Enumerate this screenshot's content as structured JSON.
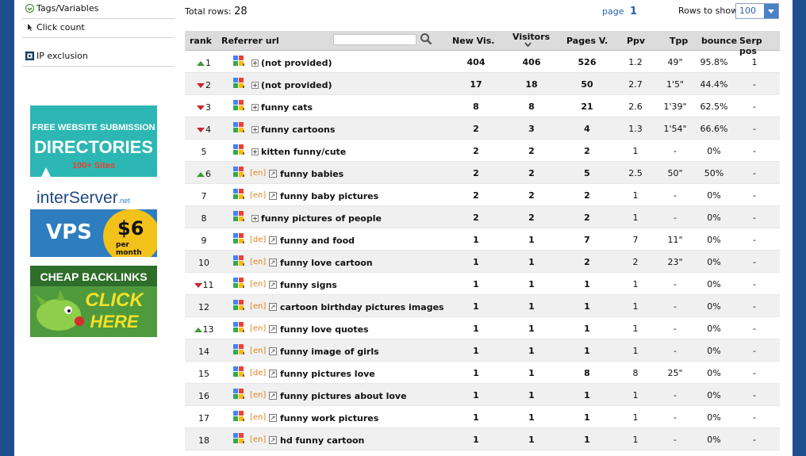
{
  "sidebar": {
    "items": [
      {
        "label": "Tags/Variables",
        "icon": "tag-icon"
      },
      {
        "label": "Click count",
        "icon": "cursor-icon"
      },
      {
        "label": "IP exclusion",
        "icon": "exclusion-icon"
      }
    ]
  },
  "ads": {
    "ad1": {
      "line1": "FREE WEBSITE SUBMISSION",
      "line2": "DIRECTORIES",
      "line3": "100+ Sites"
    },
    "ad2": {
      "brand": "interServer",
      "brand_suffix": ".net",
      "vps": "VPS",
      "price": "$6",
      "per": "per month"
    },
    "ad3": {
      "line1": "CHEAP BACKLINKS",
      "line2": "CLICK",
      "line3": "HERE"
    }
  },
  "toolbar": {
    "total_label": "Total rows:",
    "total_value": "28",
    "page_label": "page",
    "page_value": "1",
    "rows_label": "Rows to show",
    "rows_value": "100"
  },
  "table": {
    "headers": {
      "rank": "rank",
      "referrer": "Referrer url",
      "new_vis": "New Vis.",
      "visitors": "Visitors",
      "pages": "Pages V.",
      "ppv": "Ppv",
      "tpp": "Tpp",
      "bounce": "bounce",
      "serp": "Serp pos"
    },
    "rows": [
      {
        "rank": "1",
        "trend": "up",
        "lang": "",
        "kw": "(not provided)",
        "new": "404",
        "vis": "406",
        "pages": "526",
        "ppv": "1.2",
        "tpp": "49\"",
        "bounce": "95.8%",
        "serp": "1"
      },
      {
        "rank": "2",
        "trend": "down",
        "lang": "",
        "kw": "(not provided)",
        "new": "17",
        "vis": "18",
        "pages": "50",
        "ppv": "2.7",
        "tpp": "1'5\"",
        "bounce": "44.4%",
        "serp": "-"
      },
      {
        "rank": "3",
        "trend": "down",
        "lang": "",
        "kw": "funny cats",
        "new": "8",
        "vis": "8",
        "pages": "21",
        "ppv": "2.6",
        "tpp": "1'39\"",
        "bounce": "62.5%",
        "serp": "-"
      },
      {
        "rank": "4",
        "trend": "down",
        "lang": "",
        "kw": "funny cartoons",
        "new": "2",
        "vis": "3",
        "pages": "4",
        "ppv": "1.3",
        "tpp": "1'54\"",
        "bounce": "66.6%",
        "serp": "-"
      },
      {
        "rank": "5",
        "trend": "",
        "lang": "",
        "kw": "kitten funny/cute",
        "new": "2",
        "vis": "2",
        "pages": "2",
        "ppv": "1",
        "tpp": "-",
        "bounce": "0%",
        "serp": "-"
      },
      {
        "rank": "6",
        "trend": "up",
        "lang": "[en]",
        "kw": "funny babies",
        "new": "2",
        "vis": "2",
        "pages": "5",
        "ppv": "2.5",
        "tpp": "50\"",
        "bounce": "50%",
        "serp": "-"
      },
      {
        "rank": "7",
        "trend": "",
        "lang": "[en]",
        "kw": "funny baby pictures",
        "new": "2",
        "vis": "2",
        "pages": "2",
        "ppv": "1",
        "tpp": "-",
        "bounce": "0%",
        "serp": "-"
      },
      {
        "rank": "8",
        "trend": "",
        "lang": "",
        "kw": "funny pictures of people",
        "new": "2",
        "vis": "2",
        "pages": "2",
        "ppv": "1",
        "tpp": "-",
        "bounce": "0%",
        "serp": "-"
      },
      {
        "rank": "9",
        "trend": "",
        "lang": "[de]",
        "kw": "funny and food",
        "new": "1",
        "vis": "1",
        "pages": "7",
        "ppv": "7",
        "tpp": "11\"",
        "bounce": "0%",
        "serp": "-"
      },
      {
        "rank": "10",
        "trend": "",
        "lang": "[en]",
        "kw": "funny love cartoon",
        "new": "1",
        "vis": "1",
        "pages": "2",
        "ppv": "2",
        "tpp": "23\"",
        "bounce": "0%",
        "serp": "-"
      },
      {
        "rank": "11",
        "trend": "down",
        "lang": "[en]",
        "kw": "funny signs",
        "new": "1",
        "vis": "1",
        "pages": "1",
        "ppv": "1",
        "tpp": "-",
        "bounce": "0%",
        "serp": "-"
      },
      {
        "rank": "12",
        "trend": "",
        "lang": "[en]",
        "kw": "cartoon birthday pictures images",
        "new": "1",
        "vis": "1",
        "pages": "1",
        "ppv": "1",
        "tpp": "-",
        "bounce": "0%",
        "serp": "-"
      },
      {
        "rank": "13",
        "trend": "up",
        "lang": "[en]",
        "kw": "funny love quotes",
        "new": "1",
        "vis": "1",
        "pages": "1",
        "ppv": "1",
        "tpp": "-",
        "bounce": "0%",
        "serp": "-"
      },
      {
        "rank": "14",
        "trend": "",
        "lang": "[en]",
        "kw": "funny image of girls",
        "new": "1",
        "vis": "1",
        "pages": "1",
        "ppv": "1",
        "tpp": "-",
        "bounce": "0%",
        "serp": "-"
      },
      {
        "rank": "15",
        "trend": "",
        "lang": "[de]",
        "kw": "funny pictures love",
        "new": "1",
        "vis": "1",
        "pages": "8",
        "ppv": "8",
        "tpp": "25\"",
        "bounce": "0%",
        "serp": "-"
      },
      {
        "rank": "16",
        "trend": "",
        "lang": "[en]",
        "kw": "funny pictures about love",
        "new": "1",
        "vis": "1",
        "pages": "1",
        "ppv": "1",
        "tpp": "-",
        "bounce": "0%",
        "serp": "-"
      },
      {
        "rank": "17",
        "trend": "",
        "lang": "[en]",
        "kw": "funny work pictures",
        "new": "1",
        "vis": "1",
        "pages": "1",
        "ppv": "1",
        "tpp": "-",
        "bounce": "0%",
        "serp": "-"
      },
      {
        "rank": "18",
        "trend": "",
        "lang": "[en]",
        "kw": "hd funny cartoon",
        "new": "1",
        "vis": "1",
        "pages": "1",
        "ppv": "1",
        "tpp": "-",
        "bounce": "0%",
        "serp": "-"
      }
    ]
  },
  "colors": {
    "frame": "#1f4e8f",
    "accent": "#2a5fa8",
    "lang": "#e0821a",
    "up": "#3a9b2e",
    "down": "#c8232c"
  }
}
